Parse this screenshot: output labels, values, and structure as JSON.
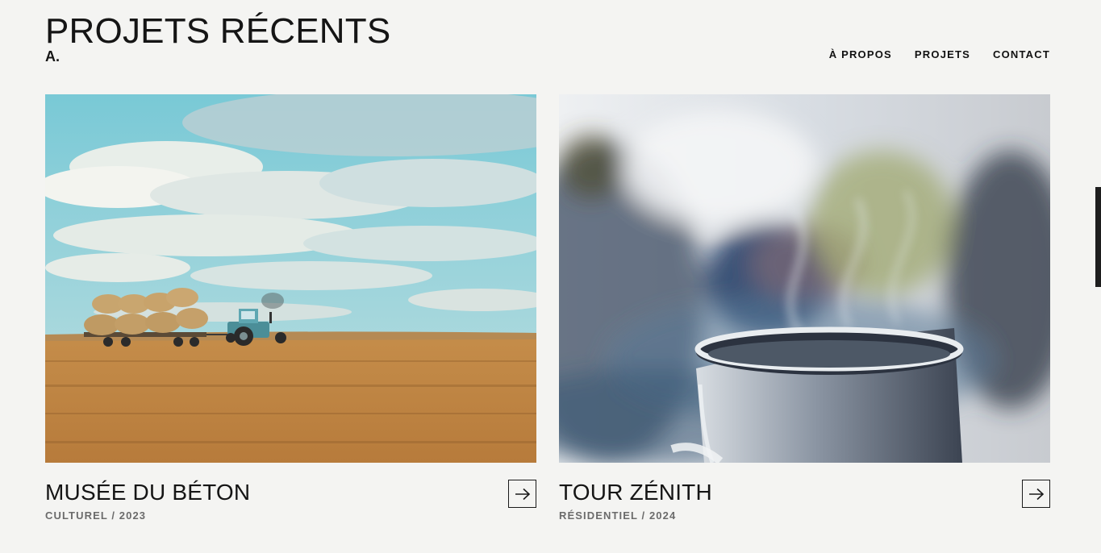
{
  "header": {
    "title": "PROJETS RÉCENTS",
    "logo": "A."
  },
  "nav": {
    "items": [
      {
        "label": "À PROPOS"
      },
      {
        "label": "PROJETS"
      },
      {
        "label": "CONTACT"
      }
    ]
  },
  "projects": [
    {
      "title": "MUSÉE DU BÉTON",
      "meta": "CULTUREL / 2023",
      "image_icon": "field-tractor-hay-photo",
      "action_icon": "arrow-right-icon"
    },
    {
      "title": "TOUR ZÉNITH",
      "meta": "RÉSIDENTIEL / 2024",
      "image_icon": "steaming-cup-photo",
      "action_icon": "arrow-right-icon"
    }
  ],
  "colors": {
    "background": "#f4f4f2",
    "text": "#151515",
    "meta_text": "#6b6b6b"
  }
}
